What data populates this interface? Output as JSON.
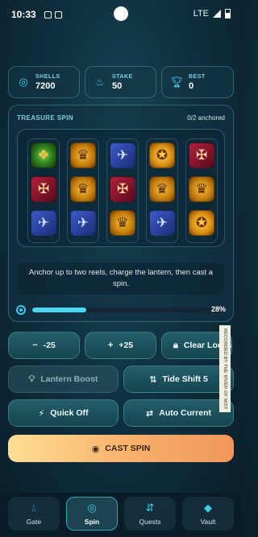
{
  "status_bar": {
    "time": "10:33",
    "network": "LTE"
  },
  "stats": [
    {
      "label": "SHELLS",
      "value": "7200",
      "icon": "shells-icon"
    },
    {
      "label": "STAKE",
      "value": "50",
      "icon": "flame-icon"
    },
    {
      "label": "BEST",
      "value": "0",
      "icon": "trophy-icon"
    }
  ],
  "treasure": {
    "title": "TREASURE SPIN",
    "anchored": "0/2 anchored",
    "reels": [
      [
        "crest",
        "cross",
        "blade"
      ],
      [
        "mask",
        "mask",
        "blade"
      ],
      [
        "blade",
        "cross",
        "mask"
      ],
      [
        "coin",
        "mask",
        "blade"
      ],
      [
        "cross",
        "mask",
        "coin"
      ]
    ],
    "hint": "Anchor up to two reels, charge the lantern, then cast a spin.",
    "charge_percent": 28,
    "charge_label": "28%"
  },
  "controls": {
    "decrease": "-25",
    "increase": "+25",
    "clear_locks": "Clear Locks",
    "lantern_boost": "Lantern Boost",
    "tide_shift": "Tide Shift 5",
    "quick_off": "Quick Off",
    "auto_current": "Auto Current",
    "cast_spin": "CAST SPIN"
  },
  "side_note": "RECORDED BY THE RIVER OF MIST LOG",
  "nav": [
    {
      "label": "Gate",
      "icon": "droplet-icon"
    },
    {
      "label": "Spin",
      "icon": "spin-icon",
      "active": true
    },
    {
      "label": "Quests",
      "icon": "quests-icon"
    },
    {
      "label": "Vault",
      "icon": "gem-icon"
    }
  ],
  "colors": {
    "accent": "#43c9ea",
    "cast_start": "#ffde95",
    "cast_end": "#f1965c"
  }
}
